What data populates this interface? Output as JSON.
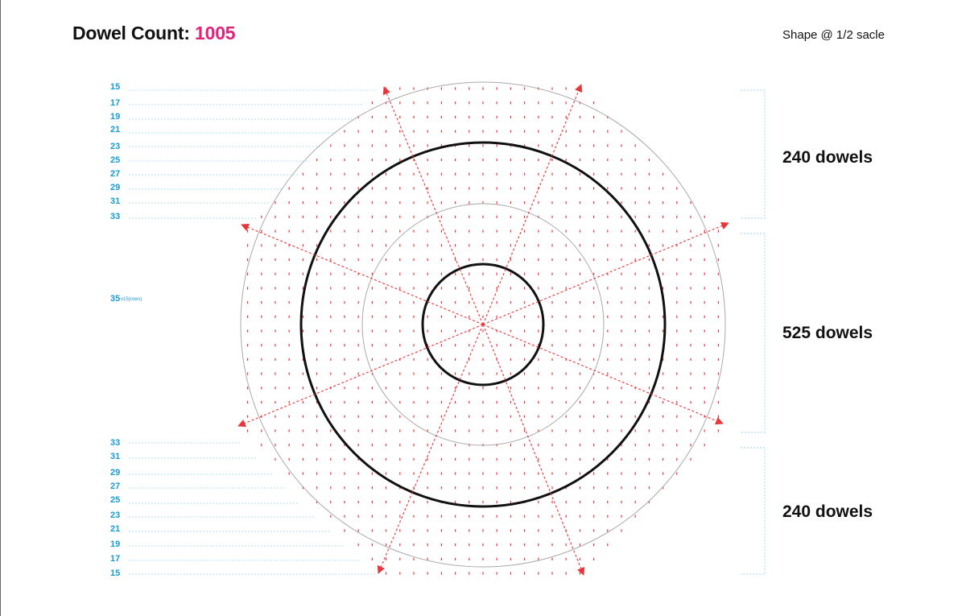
{
  "header": {
    "title_label": "Dowel Count:",
    "dowel_count": "1005",
    "scale_note": "Shape @ 1/2 sacle"
  },
  "colors": {
    "accent": "#e0237a",
    "row_label": "#1a9bd6",
    "dowel": "#e8353a",
    "guide": "#9fd4ef"
  },
  "rows_top": [
    "15",
    "17",
    "19",
    "21",
    "23",
    "25",
    "27",
    "29",
    "31",
    "33"
  ],
  "middle_row": {
    "value": "35",
    "note": "x15(rows)"
  },
  "rows_bottom": [
    "33",
    "31",
    "29",
    "27",
    "25",
    "23",
    "21",
    "19",
    "17",
    "15"
  ],
  "sections": [
    {
      "label": "240 dowels"
    },
    {
      "label": "525 dowels"
    },
    {
      "label": "240 dowels"
    }
  ]
}
